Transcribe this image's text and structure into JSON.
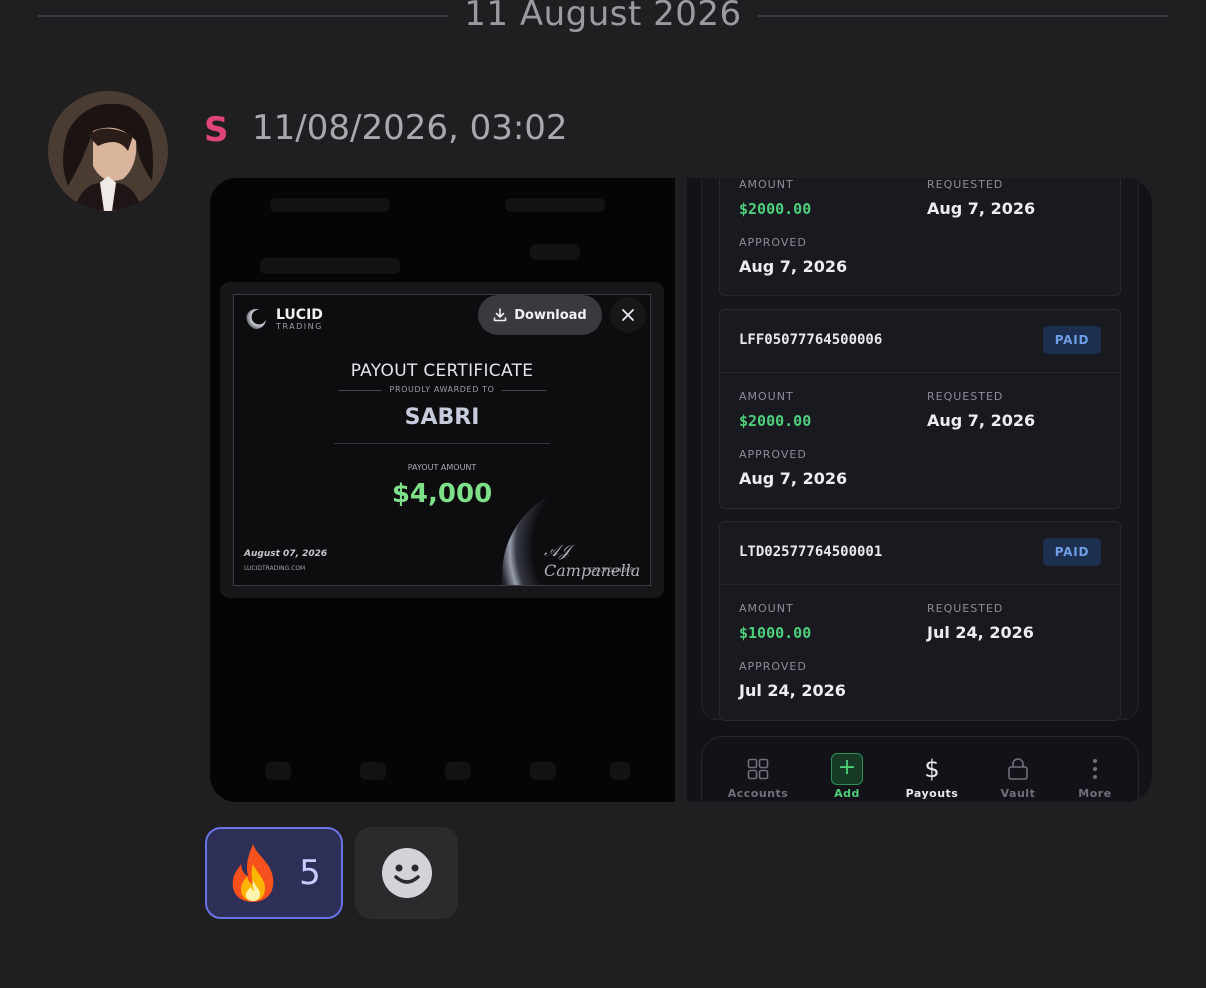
{
  "divider": {
    "date": "11 August 2026"
  },
  "message": {
    "author": "S",
    "timestamp": "11/08/2026, 03:02"
  },
  "certificate": {
    "brand_name": "LUCID",
    "brand_sub": "TRADING",
    "download_label": "Download",
    "title": "PAYOUT CERTIFICATE",
    "awarded_label": "PROUDLY AWARDED TO",
    "recipient": "SABRI",
    "amount_label": "PAYOUT AMOUNT",
    "amount": "$4,000",
    "date": "August 07, 2026",
    "website": "LUCIDTRADING.COM",
    "signature": "AJ Campanella",
    "role": "CEO, FOUNDER"
  },
  "payouts": {
    "labels": {
      "amount": "AMOUNT",
      "requested": "REQUESTED",
      "approved": "APPROVED"
    },
    "cards": [
      {
        "id": "",
        "status": "",
        "amount": "$2000.00",
        "requested": "Aug 7, 2026",
        "approved": "Aug 7, 2026"
      },
      {
        "id": "LFF05077764500006",
        "status": "PAID",
        "amount": "$2000.00",
        "requested": "Aug 7, 2026",
        "approved": "Aug 7, 2026"
      },
      {
        "id": "LTD02577764500001",
        "status": "PAID",
        "amount": "$1000.00",
        "requested": "Jul 24, 2026",
        "approved": "Jul 24, 2026"
      }
    ],
    "nav": [
      {
        "label": "Accounts",
        "icon": "grid-icon"
      },
      {
        "label": "Add",
        "icon": "plus-icon"
      },
      {
        "label": "Payouts",
        "icon": "dollar-icon"
      },
      {
        "label": "Vault",
        "icon": "lock-icon"
      },
      {
        "label": "More",
        "icon": "more-vertical-icon"
      }
    ]
  },
  "reactions": [
    {
      "emoji": "🔥",
      "count": "5",
      "selected": true
    }
  ],
  "colors": {
    "author": "#e0457a",
    "amount_green": "#4fcf7c",
    "badge_blue": "#6e9fe6",
    "reaction_border": "#6a73e6"
  }
}
